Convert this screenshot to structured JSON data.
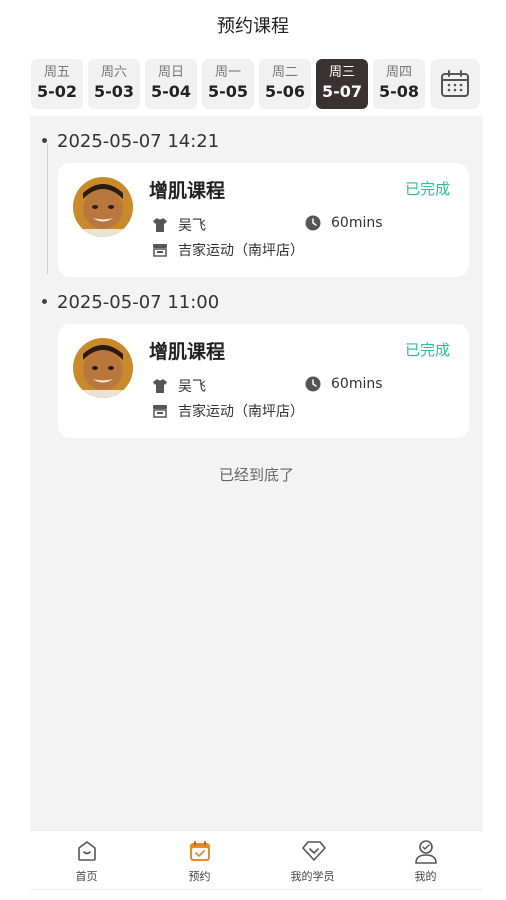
{
  "header": {
    "title": "预约课程"
  },
  "week": [
    {
      "weekday": "周五",
      "date": "5-02",
      "active": false
    },
    {
      "weekday": "周六",
      "date": "5-03",
      "active": false
    },
    {
      "weekday": "周日",
      "date": "5-04",
      "active": false
    },
    {
      "weekday": "周一",
      "date": "5-05",
      "active": false
    },
    {
      "weekday": "周二",
      "date": "5-06",
      "active": false
    },
    {
      "weekday": "周三",
      "date": "5-07",
      "active": true
    },
    {
      "weekday": "周四",
      "date": "5-08",
      "active": false
    }
  ],
  "calendar_icon": "calendar-icon",
  "bookings": [
    {
      "time": "2025-05-07 14:21",
      "course": "增肌课程",
      "status": "已完成",
      "coach": "吴飞",
      "duration": "60mins",
      "store": "吉家运动（南坪店）"
    },
    {
      "time": "2025-05-07 11:00",
      "course": "增肌课程",
      "status": "已完成",
      "coach": "吴飞",
      "duration": "60mins",
      "store": "吉家运动（南坪店）"
    }
  ],
  "end_text": "已经到底了",
  "tabbar": {
    "items": [
      {
        "label": "首页",
        "icon": "home-icon"
      },
      {
        "label": "预约",
        "icon": "calendar-check-icon"
      },
      {
        "label": "我的学员",
        "icon": "diamond-icon"
      },
      {
        "label": "我的",
        "icon": "user-icon"
      }
    ]
  },
  "colors": {
    "accent": "#e8892b",
    "success": "#2cc18c",
    "active_date_bg": "#3a3230"
  }
}
